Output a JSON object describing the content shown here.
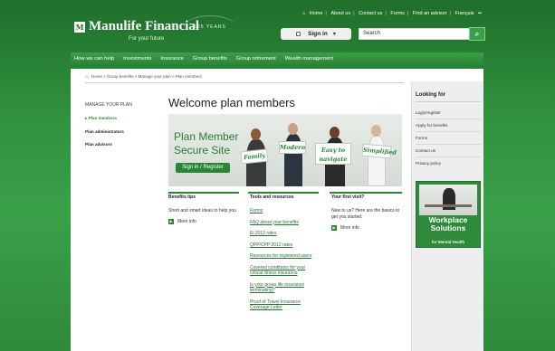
{
  "header": {
    "logo_mark": "M",
    "logo_text": "Manulife Financial",
    "tagline": "For your future",
    "years": "125 YEARS",
    "top_links": [
      "Home",
      "About us",
      "Contact us",
      "Forms",
      "Find an advisor",
      "Français"
    ],
    "signin_label": "Sign in",
    "search_placeholder": "Search"
  },
  "nav": {
    "items": [
      "How we can help",
      "Investments",
      "Insurance",
      "Group benefits",
      "Group retirement",
      "Wealth management"
    ]
  },
  "breadcrumb": "Home > Group benefits > Manage your plan > Plan members",
  "leftnav": {
    "heading": "MANAGE YOUR PLAN",
    "items": [
      "Plan members",
      "Plan administrators",
      "Plan advisors"
    ]
  },
  "main": {
    "title": "Welcome plan members",
    "banner_title_1": "Plan Member",
    "banner_title_2": "Secure Site",
    "banner_button": "Sign in / Register",
    "signs": [
      "Family",
      "Modern",
      "Easy to navigate",
      "Simplified"
    ]
  },
  "columns": {
    "benefits": {
      "title": "Benefits tips",
      "text": "Short and smart ideas to help you",
      "more": "More info"
    },
    "tools": {
      "title": "Tools and resources",
      "links": [
        "Forms",
        "FAQ about your benefits",
        "El 2012 rates",
        "QPP/CPP 2012 rates",
        "Resources for registered users",
        "Covered conditions for your critical illness insurance",
        "Is your group life insurance terminating?",
        "Proof of Travel Insurance Coverage Letter"
      ]
    },
    "first_visit": {
      "title": "Your first visit?",
      "text": "New to us? Here are the basics to get you started.",
      "more": "More info"
    }
  },
  "sidebar": {
    "title": "Looking for",
    "links": [
      "Login/register",
      "Apply for benefits",
      "Forms",
      "Contact us",
      "Privacy policy"
    ],
    "ad_title": "Workplace Solutions",
    "ad_sub": "for Mental Health"
  }
}
